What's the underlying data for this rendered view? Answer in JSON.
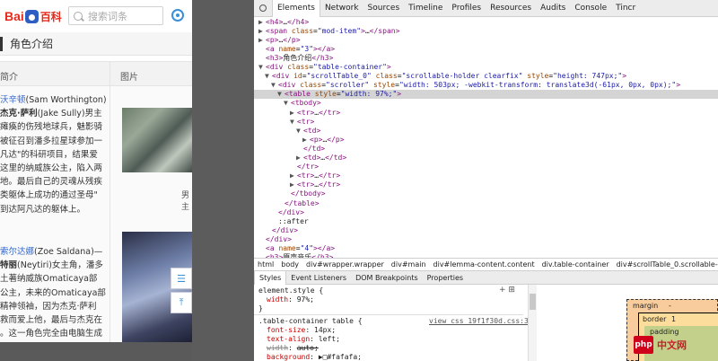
{
  "mobile": {
    "logo": {
      "left": "Bai",
      "right": "百科"
    },
    "search_placeholder": "搜索词条",
    "section_title": "角色介绍",
    "table": {
      "col1": "简介",
      "col2": "图片",
      "entry1": [
        {
          "pre": "",
          "link": "沃辛顿",
          "post": "(Sam Worthington)"
        },
        {
          "pre": "",
          "bold": "杰克·萨利",
          "post": "(Jake Sully)男主"
        },
        {
          "pre": "",
          "link": "",
          "post": "瘫痪的伤残地球兵，魅影骑"
        },
        {
          "pre": "",
          "link": "",
          "post": "被征召到潘多拉星球参加一"
        },
        {
          "pre": "",
          "link": "",
          "post": "凡达\"的科研项目，结果爱"
        },
        {
          "pre": "",
          "link": "",
          "post": "这里的纳威族公主，陷入两"
        },
        {
          "pre": "",
          "link": "",
          "post": "地。最后自己的灵魂从残疾"
        },
        {
          "pre": "",
          "link": "",
          "post": "类躯体上成功的通过圣母\""
        },
        {
          "pre": "",
          "link": "",
          "post": "到达阿凡达的躯体上。"
        }
      ],
      "entry2": [
        {
          "pre": "",
          "link": "索尔达娜",
          "post": "(Zoe Saldana)—"
        },
        {
          "pre": "",
          "bold": "特丽",
          "post": "(Neytiri)女主角，潘多"
        },
        {
          "pre": "",
          "link": "",
          "post": "土著纳威族Omaticaya部"
        },
        {
          "pre": "",
          "link": "",
          "post": "公主，未来的Omaticaya部"
        },
        {
          "pre": "",
          "link": "",
          "post": "精神领袖，因为杰克·萨利"
        },
        {
          "pre": "",
          "link": "",
          "post": "救而爱上他，最后与杰克在"
        },
        {
          "pre": "",
          "link": "",
          "post": "。这一角色完全由电脑生成"
        }
      ],
      "img1_caption": "男主"
    }
  },
  "devtools": {
    "tabs": [
      "Elements",
      "Network",
      "Sources",
      "Timeline",
      "Profiles",
      "Resources",
      "Audits",
      "Console",
      "Tincr"
    ],
    "dom_lines": [
      {
        "indent": 4,
        "arrow": "▶",
        "html": "<h4>…</h4>"
      },
      {
        "indent": 4,
        "arrow": "▶",
        "html": "<span class=\"mod-item\">…</span>"
      },
      {
        "indent": 4,
        "arrow": "▶",
        "html": "<p>…</p>"
      },
      {
        "indent": 4,
        "arrow": "",
        "html": "<a name=\"3\"></a>"
      },
      {
        "indent": 4,
        "arrow": "",
        "html": "<h3>角色介绍</h3>"
      },
      {
        "indent": 4,
        "arrow": "▼",
        "html": "<div class=\"table-container\">"
      },
      {
        "indent": 5,
        "arrow": "▼",
        "html": "<div id=\"scrollTable_0\" class=\"scrollable-holder clearfix\" style=\"height: 747px;\">"
      },
      {
        "indent": 6,
        "arrow": "▼",
        "html": "<div class=\"scroller\" style=\"width: 503px; -webkit-transform: translate3d(-61px, 0px, 0px);\">"
      },
      {
        "indent": 7,
        "arrow": "▼",
        "html": "<table style=\"width: 97%;\">"
      },
      {
        "indent": 8,
        "arrow": "▼",
        "html": "<tbody>"
      },
      {
        "indent": 9,
        "arrow": "▶",
        "html": "<tr>…</tr>"
      },
      {
        "indent": 9,
        "arrow": "▼",
        "html": "<tr>"
      },
      {
        "indent": 10,
        "arrow": "▼",
        "html": "<td>"
      },
      {
        "indent": 11,
        "arrow": "▶",
        "html": "<p>…</p>"
      },
      {
        "indent": 10,
        "arrow": "",
        "html": "</td>"
      },
      {
        "indent": 10,
        "arrow": "▶",
        "html": "<td>…</td>"
      },
      {
        "indent": 9,
        "arrow": "",
        "html": "</tr>"
      },
      {
        "indent": 9,
        "arrow": "▶",
        "html": "<tr>…</tr>"
      },
      {
        "indent": 9,
        "arrow": "▶",
        "html": "<tr>…</tr>"
      },
      {
        "indent": 8,
        "arrow": "",
        "html": "</tbody>"
      },
      {
        "indent": 7,
        "arrow": "",
        "html": "</table>"
      },
      {
        "indent": 6,
        "arrow": "",
        "html": "</div>"
      },
      {
        "indent": 6,
        "arrow": "",
        "html": "::after"
      },
      {
        "indent": 5,
        "arrow": "",
        "html": "</div>"
      },
      {
        "indent": 4,
        "arrow": "",
        "html": "</div>"
      },
      {
        "indent": 4,
        "arrow": "",
        "html": "<a name=\"4\"></a>"
      },
      {
        "indent": 4,
        "arrow": "",
        "html": "<h3>原声音乐</h3>"
      }
    ],
    "selected_line": 8,
    "breadcrumbs": [
      "html",
      "body",
      "div#wrapper.wrapper",
      "div#main",
      "div#lemma-content.content",
      "div.table-container",
      "div#scrollTable_0.scrollable-holder.clearfi"
    ],
    "subtabs": [
      "Styles",
      "Event Listeners",
      "DOM Breakpoints",
      "Properties"
    ],
    "styles": {
      "element_style": "element.style {",
      "rule1_prop": "width",
      "rule1_val": "97%;",
      "close": "}",
      "selector2": ".table-container table {",
      "link2": "view_css_19f1f30d.css:3",
      "props2": [
        {
          "name": "font-size",
          "value": "14px;",
          "struck": false
        },
        {
          "name": "text-align",
          "value": "left;",
          "struck": false
        },
        {
          "name": "width",
          "value": "auto;",
          "struck": true
        },
        {
          "name": "background",
          "value": "▶□#fafafa;",
          "struck": false
        }
      ]
    },
    "box_model": {
      "margin": "margin",
      "margin_val": "-",
      "border": "border",
      "border_val": "1",
      "padding": "padding"
    }
  },
  "watermark": {
    "badge": "php",
    "text": "中文网"
  }
}
